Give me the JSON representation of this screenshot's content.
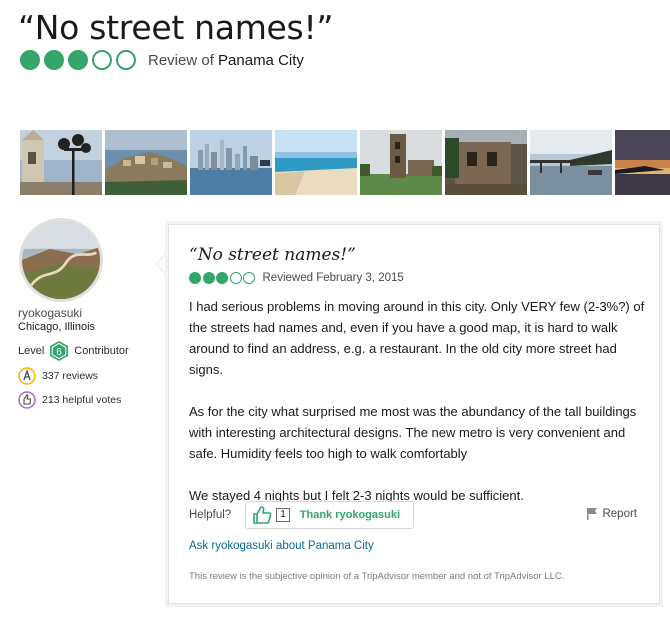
{
  "header": {
    "title": "“No street names!”",
    "overall_rating": 3,
    "rating_max": 5,
    "review_of_prefix": "Review of",
    "review_of_city": "Panama City"
  },
  "photos": [
    {
      "icon": "street-lamp-church-photo"
    },
    {
      "icon": "old-town-aerial-photo"
    },
    {
      "icon": "skyline-bay-photo"
    },
    {
      "icon": "beach-photo"
    },
    {
      "icon": "ruins-tower-photo"
    },
    {
      "icon": "stone-ruins-photo"
    },
    {
      "icon": "canal-bridge-photo"
    },
    {
      "icon": "sunset-photo"
    }
  ],
  "reviewer": {
    "username": "ryokogasuki",
    "location": "Chicago, Illinois",
    "level_label": "Level",
    "level_number": "6",
    "level_title": "Contributor",
    "reviews": "337 reviews",
    "helpful_votes": "213 helpful votes"
  },
  "review": {
    "title": "“No street names!”",
    "rating": 3,
    "rating_max": 5,
    "date": "Reviewed February 3, 2015",
    "paragraphs": [
      "I had serious problems in moving around in this city. Only VERY few (2-3%?) of the streets had names and, even if you have a good map, it is hard to walk around to find an address, e.g. a restaurant. In the old city more street had signs.",
      "As for the city what surprised me most was the abundancy of the tall buildings with interesting architectural designs. The new metro is very convenient and safe. Humidity feels too high to walk comfortably",
      "We stayed 4 nights but I felt 2-3 nights would be sufficient."
    ],
    "helpful_label": "Helpful?",
    "thank_count": "1",
    "thank_label": "Thank ryokogasuki",
    "report_label": "Report",
    "ask_link": "Ask ryokogasuki about Panama City",
    "disclaimer": "This review is the subjective opinion of a TripAdvisor member and not of TripAdvisor LLC."
  },
  "colors": {
    "bubble_green": "#34a66c",
    "link_blue": "#076a9c"
  }
}
